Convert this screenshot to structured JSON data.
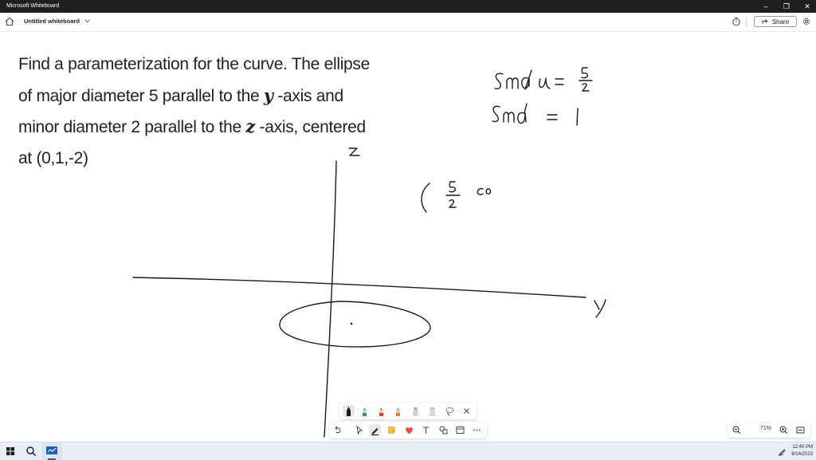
{
  "window": {
    "title": "Microsoft Whiteboard",
    "minimize": "–",
    "restore": "❐",
    "close": "✕"
  },
  "toolbar": {
    "doc_title": "Untitled whiteboard",
    "share_label": "Share"
  },
  "problem": {
    "line1": "Find a parameterization for the curve. The ellipse",
    "line2_a": "of major diameter 5 parallel to the ",
    "var_y": "y",
    "line2_b": " -axis and",
    "line3_a": "minor diameter 2 parallel to the ",
    "var_z": "z",
    "line3_b": " -axis, centered",
    "line4": "at (0,1,-2)"
  },
  "zoom": {
    "level": "71%"
  },
  "clock": {
    "time": "12:40 PM",
    "date": "8/14/2023"
  },
  "colors": {
    "titlebar": "#1f1f1f",
    "taskbar": "#e9eef5",
    "pen_black": "#1a1a1a",
    "pen_green": "#2e9e4e",
    "pen_red": "#d93a3a",
    "pen_orange": "#e0822f",
    "highlighter_pink": "#f07a9a",
    "sticky_yellow": "#f5c022",
    "reaction_red": "#e8503a"
  }
}
